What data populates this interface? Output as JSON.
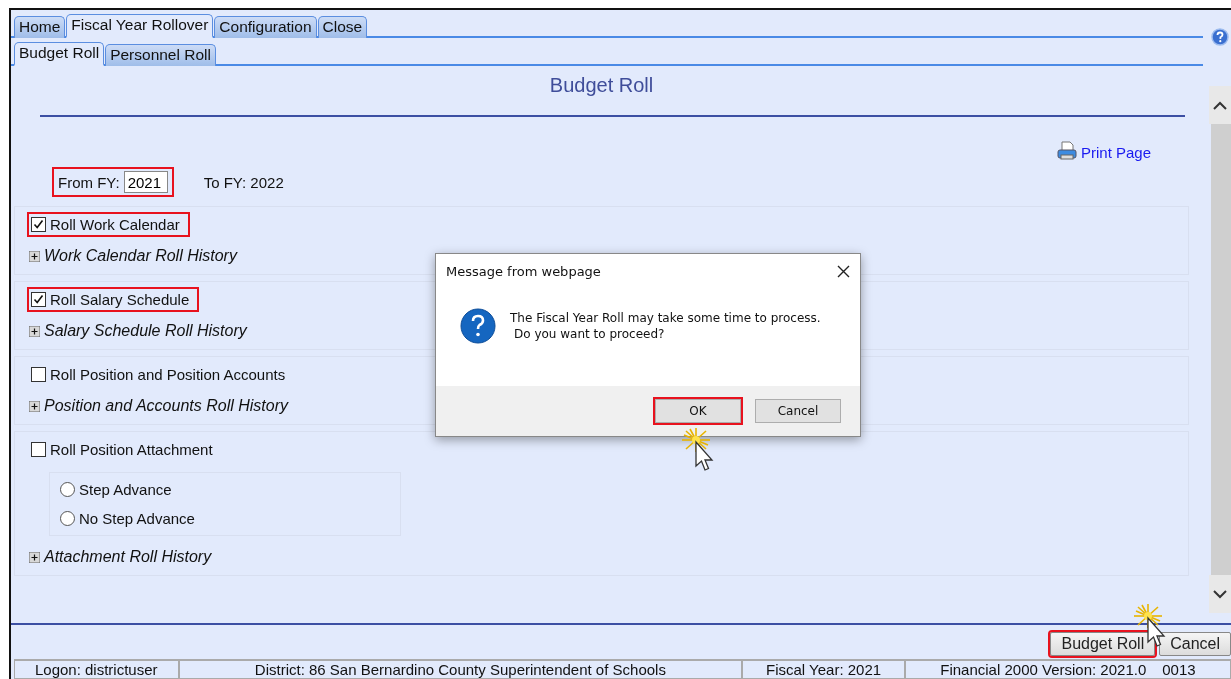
{
  "tabs": [
    {
      "label": "Home",
      "selected": false
    },
    {
      "label": "Fiscal Year Rollover",
      "selected": true
    },
    {
      "label": "Configuration",
      "selected": false
    },
    {
      "label": "Close",
      "selected": false
    }
  ],
  "subtabs": [
    {
      "label": "Budget Roll",
      "selected": true
    },
    {
      "label": "Personnel Roll",
      "selected": false
    }
  ],
  "title": "Budget Roll",
  "print_link": "Print Page",
  "from_fy": {
    "label": "From FY:",
    "value": "2021",
    "highlighted": true
  },
  "to_fy": "To FY: 2022",
  "sections": [
    {
      "option": {
        "label": "Roll Work Calendar",
        "checked": true,
        "highlighted": true
      },
      "history": "Work Calendar Roll History"
    },
    {
      "option": {
        "label": "Roll Salary Schedule",
        "checked": true,
        "highlighted": true
      },
      "history": "Salary Schedule Roll History"
    },
    {
      "option": {
        "label": "Roll Position and Position Accounts",
        "checked": false,
        "highlighted": false
      },
      "history": "Position and Accounts Roll History"
    },
    {
      "option": {
        "label": "Roll Position Attachment",
        "checked": false,
        "highlighted": false
      },
      "radios": [
        {
          "label": "Step Advance",
          "selected": false
        },
        {
          "label": "No Step Advance",
          "selected": false
        }
      ],
      "history": "Attachment Roll History"
    }
  ],
  "buttons": [
    {
      "label": "Budget Roll",
      "highlighted": true
    },
    {
      "label": "Cancel",
      "highlighted": false
    }
  ],
  "status_bar": [
    {
      "kind": "cell",
      "text": "Logon: districtuser"
    },
    {
      "kind": "cell",
      "text": "District: 86 San Bernardino County Superintendent of Schools"
    },
    {
      "kind": "cell",
      "text": "Fiscal Year: 2021"
    },
    {
      "kind": "split",
      "parts": [
        "Financial 2000 Version: 2021.0",
        "0013"
      ]
    }
  ],
  "dialog": {
    "title": "Message from webpage",
    "message": [
      "The Fiscal Year Roll may take some time to process.",
      "Do you want to proceed?"
    ],
    "buttons": [
      {
        "label": "OK",
        "highlighted": true
      },
      {
        "label": "Cancel",
        "highlighted": false
      }
    ]
  }
}
